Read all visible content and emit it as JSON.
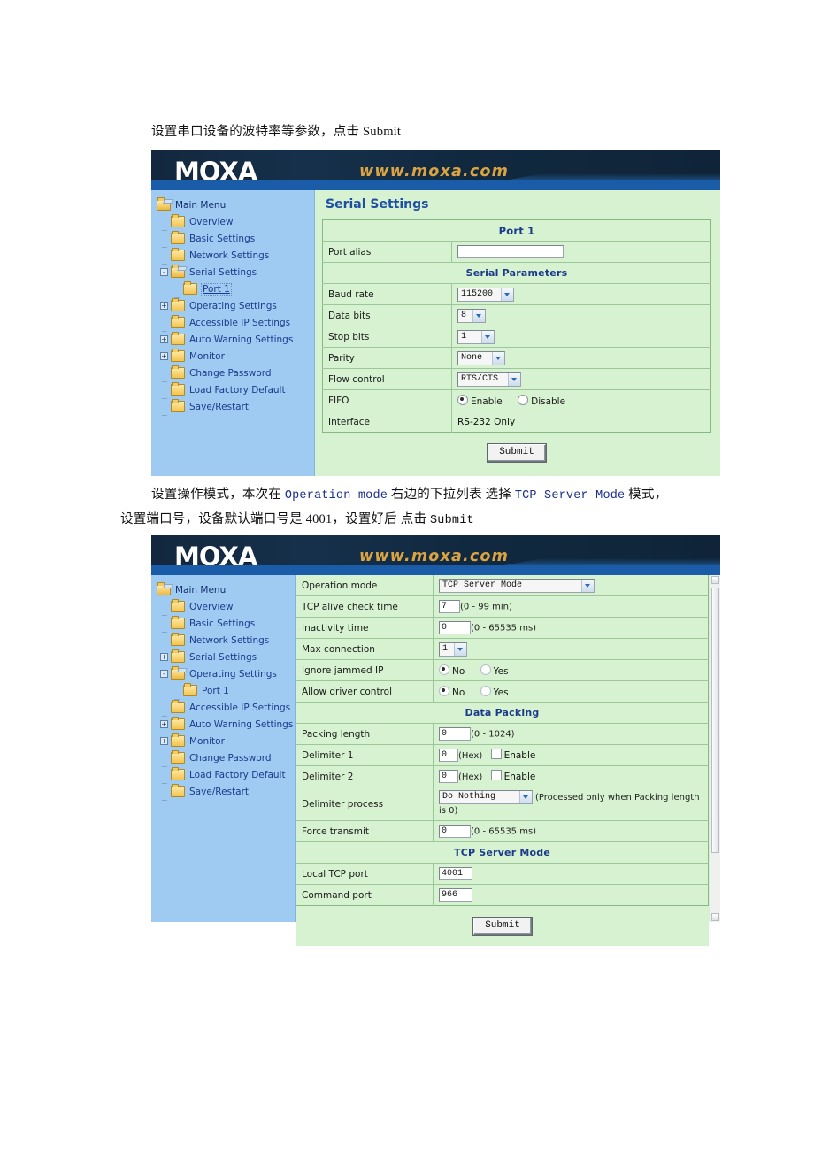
{
  "doc": {
    "para1": "设置串口设备的波特率等参数，点击 Submit",
    "para2_a": "设置操作模式，本次在 ",
    "para2_code1": "Operation mode",
    "para2_b": " 右边的下拉列表 选择 ",
    "para2_code2": "TCP Server Mode",
    "para2_c": " 模式，",
    "para2_line2_a": "设置端口号，设备默认端口号是 4001，设置好后 点击 ",
    "para2_line2_code": "Submit"
  },
  "banner": {
    "logo": "MOXA",
    "url": "www.moxa.com"
  },
  "sidebar1": {
    "items": [
      {
        "label": "Main Menu",
        "indent": 0,
        "toggle": "",
        "folder": "open",
        "current": false
      },
      {
        "label": "Overview",
        "indent": 1,
        "toggle": "",
        "folder": "closed",
        "current": false
      },
      {
        "label": "Basic Settings",
        "indent": 1,
        "toggle": "",
        "folder": "closed",
        "current": false
      },
      {
        "label": "Network Settings",
        "indent": 1,
        "toggle": "",
        "folder": "closed",
        "current": false
      },
      {
        "label": "Serial Settings",
        "indent": 1,
        "toggle": "-",
        "folder": "open",
        "current": false
      },
      {
        "label": "Port 1",
        "indent": 2,
        "toggle": "",
        "folder": "closed",
        "current": true
      },
      {
        "label": "Operating Settings",
        "indent": 1,
        "toggle": "+",
        "folder": "closed",
        "current": false
      },
      {
        "label": "Accessible IP Settings",
        "indent": 1,
        "toggle": "",
        "folder": "closed",
        "current": false
      },
      {
        "label": "Auto Warning Settings",
        "indent": 1,
        "toggle": "+",
        "folder": "closed",
        "current": false
      },
      {
        "label": "Monitor",
        "indent": 1,
        "toggle": "+",
        "folder": "closed",
        "current": false
      },
      {
        "label": "Change Password",
        "indent": 1,
        "toggle": "",
        "folder": "closed",
        "current": false
      },
      {
        "label": "Load Factory Default",
        "indent": 1,
        "toggle": "",
        "folder": "closed",
        "current": false
      },
      {
        "label": "Save/Restart",
        "indent": 1,
        "toggle": "",
        "folder": "closed",
        "current": false
      }
    ]
  },
  "sidebar2": {
    "items": [
      {
        "label": "Main Menu",
        "indent": 0,
        "toggle": "",
        "folder": "open",
        "current": false
      },
      {
        "label": "Overview",
        "indent": 1,
        "toggle": "",
        "folder": "closed",
        "current": false
      },
      {
        "label": "Basic Settings",
        "indent": 1,
        "toggle": "",
        "folder": "closed",
        "current": false
      },
      {
        "label": "Network Settings",
        "indent": 1,
        "toggle": "",
        "folder": "closed",
        "current": false
      },
      {
        "label": "Serial Settings",
        "indent": 1,
        "toggle": "+",
        "folder": "closed",
        "current": false
      },
      {
        "label": "Operating Settings",
        "indent": 1,
        "toggle": "-",
        "folder": "open",
        "current": false
      },
      {
        "label": "Port 1",
        "indent": 2,
        "toggle": "",
        "folder": "closed",
        "current": false
      },
      {
        "label": "Accessible IP Settings",
        "indent": 1,
        "toggle": "",
        "folder": "closed",
        "current": false
      },
      {
        "label": "Auto Warning Settings",
        "indent": 1,
        "toggle": "+",
        "folder": "closed",
        "current": false
      },
      {
        "label": "Monitor",
        "indent": 1,
        "toggle": "+",
        "folder": "closed",
        "current": false
      },
      {
        "label": "Change Password",
        "indent": 1,
        "toggle": "",
        "folder": "closed",
        "current": false
      },
      {
        "label": "Load Factory Default",
        "indent": 1,
        "toggle": "",
        "folder": "closed",
        "current": false
      },
      {
        "label": "Save/Restart",
        "indent": 1,
        "toggle": "",
        "folder": "closed",
        "current": false
      }
    ]
  },
  "serial": {
    "title": "Serial Settings",
    "section_port": "Port 1",
    "section_params": "Serial Parameters",
    "port_alias_label": "Port alias",
    "port_alias_value": "",
    "baud_label": "Baud rate",
    "baud_value": "115200",
    "data_bits_label": "Data bits",
    "data_bits_value": "8",
    "stop_bits_label": "Stop bits",
    "stop_bits_value": "1",
    "parity_label": "Parity",
    "parity_value": "None",
    "flow_label": "Flow control",
    "flow_value": "RTS/CTS",
    "fifo_label": "FIFO",
    "fifo_enable": "Enable",
    "fifo_disable": "Disable",
    "interface_label": "Interface",
    "interface_value": "RS-232 Only",
    "submit": "Submit"
  },
  "operating": {
    "op_mode_label": "Operation mode",
    "op_mode_value": "TCP Server Mode",
    "alive_label": "TCP alive check time",
    "alive_value": "7",
    "alive_hint": "(0 - 99 min)",
    "inactivity_label": "Inactivity time",
    "inactivity_value": "0",
    "inactivity_hint": "(0 - 65535 ms)",
    "maxconn_label": "Max connection",
    "maxconn_value": "1",
    "jammed_label": "Ignore jammed IP",
    "driver_label": "Allow driver control",
    "opt_no": "No",
    "opt_yes": "Yes",
    "section_packing": "Data Packing",
    "packlen_label": "Packing length",
    "packlen_value": "0",
    "packlen_hint": "(0 - 1024)",
    "delim1_label": "Delimiter 1",
    "delim1_value": "0",
    "delim2_label": "Delimiter 2",
    "delim2_value": "0",
    "hex_hint": "(Hex)",
    "enable_label": "Enable",
    "delimproc_label": "Delimiter process",
    "delimproc_value": "Do Nothing",
    "delimproc_hint": "(Processed only when Packing length is 0)",
    "force_label": "Force transmit",
    "force_value": "0",
    "force_hint": "(0 - 65535 ms)",
    "section_tcp": "TCP Server Mode",
    "localport_label": "Local TCP port",
    "localport_value": "4001",
    "cmdport_label": "Command port",
    "cmdport_value": "966",
    "submit": "Submit"
  }
}
